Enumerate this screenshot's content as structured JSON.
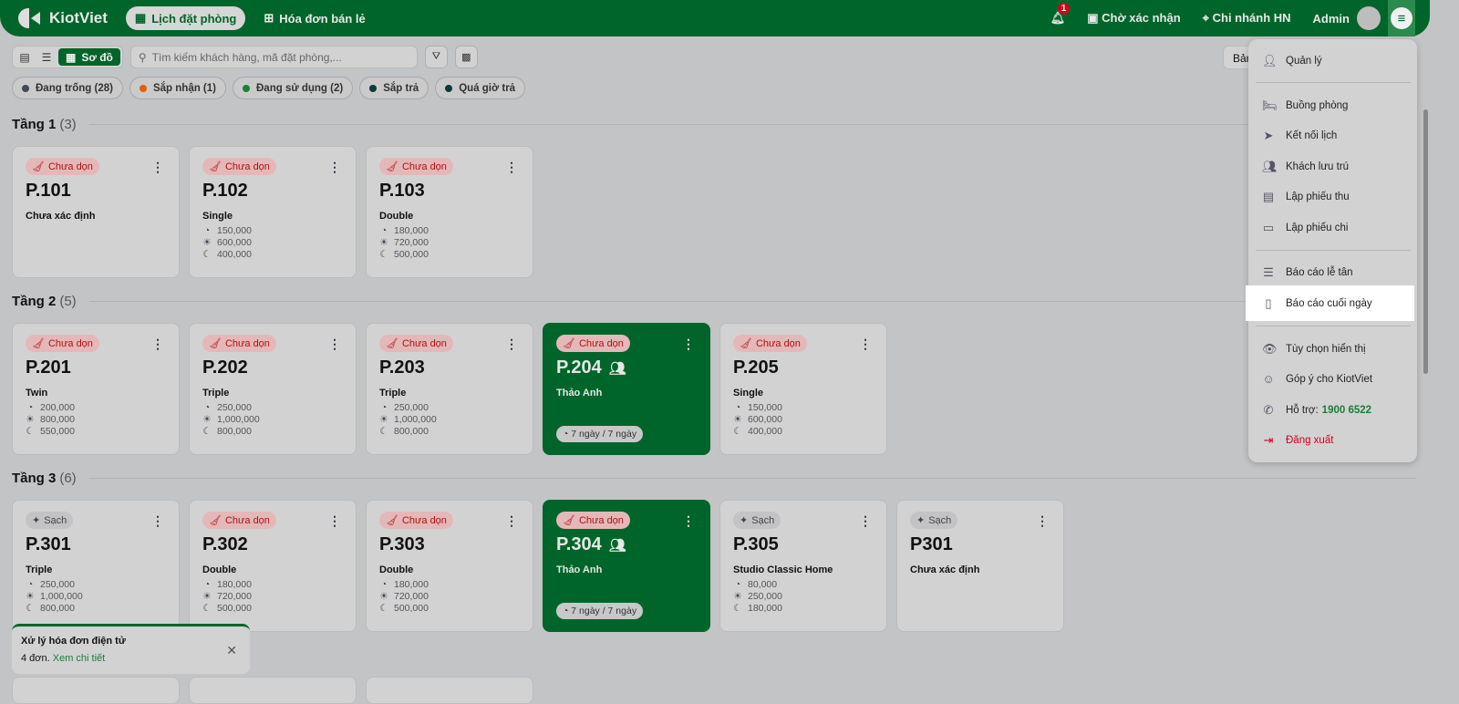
{
  "header": {
    "brand": "KiotViet",
    "tabs": [
      {
        "label": "Lịch đặt phòng",
        "active": true
      },
      {
        "label": "Hóa đơn bán lẻ"
      }
    ],
    "notifications": "1",
    "pending": "Chờ xác nhận",
    "branch": "Chi nhánh HN",
    "user": "Admin"
  },
  "toolbar": {
    "view_active": "Sơ đồ",
    "search_placeholder": "Tìm kiếm khách hàng, mã đặt phòng,...",
    "partial_button": "Bản"
  },
  "filters": [
    {
      "label": "Đang trống (28)",
      "color": "#444a55"
    },
    {
      "label": "Sắp nhận (1)",
      "color": "#e0600a"
    },
    {
      "label": "Đang sử dụng (2)",
      "color": "#1a7f36"
    },
    {
      "label": "Sắp trả",
      "color": "#0f3a36"
    },
    {
      "label": "Quá giờ trả",
      "color": "#0f3a36"
    }
  ],
  "floors": [
    {
      "name": "Tầng 1",
      "count": "(3)",
      "rooms": [
        {
          "status": "Chưa dọn",
          "name": "P.101",
          "type": "Chưa xác định"
        },
        {
          "status": "Chưa dọn",
          "name": "P.102",
          "type": "Single",
          "prices": [
            "150,000",
            "600,000",
            "400,000"
          ]
        },
        {
          "status": "Chưa dọn",
          "name": "P.103",
          "type": "Double",
          "prices": [
            "180,000",
            "720,000",
            "500,000"
          ]
        }
      ]
    },
    {
      "name": "Tầng 2",
      "count": "(5)",
      "rooms": [
        {
          "status": "Chưa dọn",
          "name": "P.201",
          "type": "Twin",
          "prices": [
            "200,000",
            "800,000",
            "550,000"
          ]
        },
        {
          "status": "Chưa dọn",
          "name": "P.202",
          "type": "Triple",
          "prices": [
            "250,000",
            "1,000,000",
            "800,000"
          ]
        },
        {
          "status": "Chưa dọn",
          "name": "P.203",
          "type": "Triple",
          "prices": [
            "250,000",
            "1,000,000",
            "800,000"
          ]
        },
        {
          "status": "Chưa dọn",
          "name": "P.204",
          "type": "Thảo Anh",
          "occupied": true,
          "stay": "7 ngày / 7 ngày"
        },
        {
          "status": "Chưa dọn",
          "name": "P.205",
          "type": "Single",
          "prices": [
            "150,000",
            "600,000",
            "400,000"
          ]
        }
      ]
    },
    {
      "name": "Tầng 3",
      "count": "(6)",
      "rooms": [
        {
          "status": "Sạch",
          "name": "P.301",
          "type": "Triple",
          "prices": [
            "250,000",
            "1,000,000",
            "800,000"
          ]
        },
        {
          "status": "Chưa dọn",
          "name": "P.302",
          "type": "Double",
          "prices": [
            "180,000",
            "720,000",
            "500,000"
          ]
        },
        {
          "status": "Chưa dọn",
          "name": "P.303",
          "type": "Double",
          "prices": [
            "180,000",
            "720,000",
            "500,000"
          ]
        },
        {
          "status": "Chưa dọn",
          "name": "P.304",
          "type": "Thảo Anh",
          "occupied": true,
          "stay": "7 ngày / 7 ngày"
        },
        {
          "status": "Sạch",
          "name": "P.305",
          "type": "Studio Classic Home",
          "prices": [
            "80,000",
            "250,000",
            "180,000"
          ]
        },
        {
          "status": "Sạch",
          "name": "P301",
          "type": "Chưa xác định"
        }
      ]
    }
  ],
  "toast": {
    "title": "Xử lý hóa đơn điện tử",
    "count": "4 đơn.",
    "link": "Xem chi tiết"
  },
  "menu": {
    "items": [
      {
        "label": "Quản lý",
        "icon": "manager-icon"
      },
      {
        "label": "Buồng phòng",
        "icon": "bed-icon"
      },
      {
        "label": "Kết nối lịch",
        "icon": "share-icon"
      },
      {
        "label": "Khách lưu trú",
        "icon": "guests-icon"
      },
      {
        "label": "Lập phiếu thu",
        "icon": "receipt-icon"
      },
      {
        "label": "Lập phiếu chi",
        "icon": "payment-icon"
      },
      {
        "label": "Báo cáo lễ tân",
        "icon": "report-icon"
      },
      {
        "label": "Báo cáo cuối ngày",
        "icon": "file-chart-icon",
        "highlighted": true
      },
      {
        "label": "Tùy chọn hiển thị",
        "icon": "eye-icon"
      },
      {
        "label": "Góp ý cho KiotViet",
        "icon": "feedback-icon"
      },
      {
        "label": "Hỗ trợ:",
        "icon": "phone-icon",
        "phone": "1900 6522"
      },
      {
        "label": "Đăng xuất",
        "icon": "logout-icon"
      }
    ]
  }
}
